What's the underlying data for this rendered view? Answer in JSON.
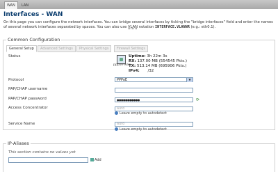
{
  "top_tabs": [
    "WAN",
    "LAN"
  ],
  "page_title": "Interfaces - WAN",
  "description_line1": "On this page you can configure the network interfaces. You can bridge several interfaces by ticking the \"bridge interfaces\" field and enter the names",
  "description_line2_prefix": "of several network interfaces separated by spaces. You can also use ",
  "description_vlan": "VLAN",
  "description_mid": " notation ",
  "description_code": "INTERFACE.VLANNR",
  "description_suffix": " (e.g.: eth0.1).",
  "common_config": {
    "legend": "Common Configuration",
    "tabs": [
      "General Setup",
      "Advanced Settings",
      "Physical Settings",
      "Firewall Settings"
    ]
  },
  "status": {
    "label": "Status",
    "interface_name": "pppoe-wan",
    "uptime_label": "Uptime:",
    "uptime_value": "3h 22m 3s",
    "rx_label": "RX:",
    "rx_value": "137.00 MB (554545 Pkts.)",
    "tx_label": "TX:",
    "tx_value": "513.14 MB (695906 Pkts.)",
    "ipv4_label": "IPv4:",
    "ipv4_value": "/32"
  },
  "protocol": {
    "label": "Protocol",
    "value": "PPPoE"
  },
  "pap_username": {
    "label": "PAP/CHAP username",
    "value": ""
  },
  "pap_password": {
    "label": "PAP/CHAP password",
    "value": "●●●●●●●●●●●"
  },
  "access_concentrator": {
    "label": "Access Concentrator",
    "placeholder": "auto",
    "hint": "Leave empty to autodetect"
  },
  "service_name": {
    "label": "Service Name",
    "placeholder": "auto",
    "hint": "Leave empty to autodetect"
  },
  "ip_aliases": {
    "legend": "IP-Aliases",
    "empty_note": "This section contains no values yet",
    "add_label": "Add"
  }
}
